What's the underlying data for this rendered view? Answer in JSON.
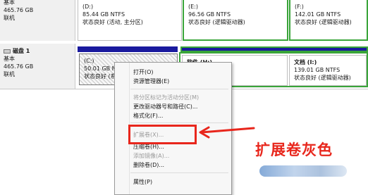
{
  "disks": [
    {
      "label": "",
      "type": "基本",
      "size": "465.76 GB",
      "status": "联机",
      "volumes": [
        {
          "name": "(D:)",
          "size": "85.44 GB NTFS",
          "status": "状态良好 (活动, 主分区)"
        },
        {
          "name": "(E:)",
          "size": "96.56 GB NTFS",
          "status": "状态良好 (逻辑驱动器)"
        },
        {
          "name": "(F:)",
          "size": "142.01 GB NTFS",
          "status": "状态良好 (逻辑驱动器)"
        }
      ]
    },
    {
      "label": "磁盘 1",
      "type": "基本",
      "size": "465.76 GB",
      "status": "联机",
      "volumes": [
        {
          "name": "(C:)",
          "size": "50.01 GB N",
          "status": "状态良好 (系"
        },
        {
          "name": "软件 (H:)",
          "size": "",
          "status": ""
        },
        {
          "name": "文档 (I:)",
          "size": "139.01 GB NTFS",
          "status": "状态良好 (逻辑驱动器)"
        }
      ]
    }
  ],
  "context_menu": {
    "items": [
      {
        "label": "打开(O)",
        "disabled": false
      },
      {
        "label": "资源管理器(E)",
        "disabled": false
      },
      {
        "label": "将分区标记为活动分区(M)",
        "disabled": true
      },
      {
        "label": "更改驱动器号和路径(C)...",
        "disabled": false
      },
      {
        "label": "格式化(F)...",
        "disabled": false
      },
      {
        "label": "扩展卷(X)...",
        "disabled": true
      },
      {
        "label": "压缩卷(H)...",
        "disabled": false
      },
      {
        "label": "添加镜像(A)...",
        "disabled": true
      },
      {
        "label": "删除卷(D)...",
        "disabled": false
      },
      {
        "label": "属性(P)",
        "disabled": false
      }
    ]
  },
  "annotation": {
    "text": "扩展卷灰色",
    "color": "#e8261c"
  },
  "colors": {
    "primary_partition_bar": "#1a1a9e",
    "logical_drive_border": "#3aa53a"
  }
}
